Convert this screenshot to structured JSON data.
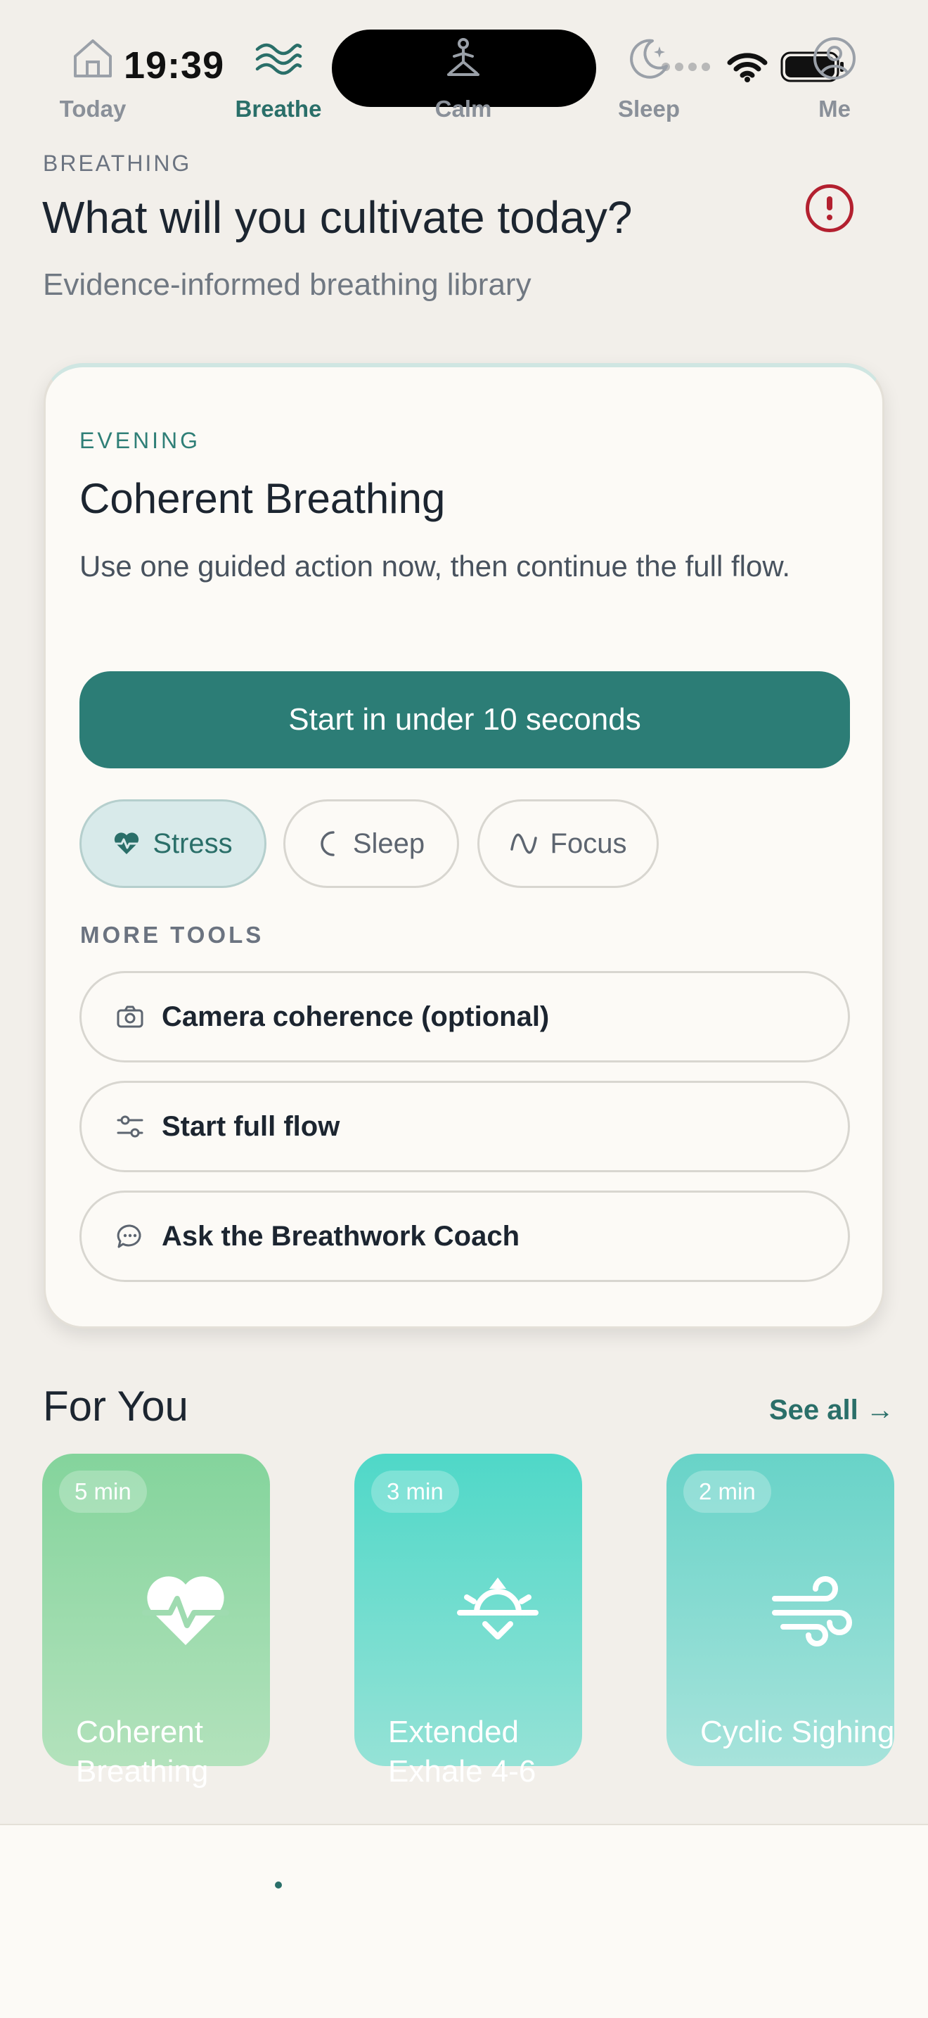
{
  "status_bar": {
    "time": "19:39"
  },
  "header": {
    "eyebrow": "BREATHING",
    "title": "What will you cultivate today?",
    "subtitle": "Evidence-informed breathing library",
    "alert_icon": "alert-circle-icon"
  },
  "hero": {
    "eyebrow": "EVENING",
    "title": "Coherent Breathing",
    "description": "Use one guided action now, then continue the full flow.",
    "cta_label": "Start in under 10 seconds",
    "chips": [
      {
        "label": "Stress",
        "icon": "heart-pulse-icon",
        "active": true
      },
      {
        "label": "Sleep",
        "icon": "moon-icon",
        "active": false
      },
      {
        "label": "Focus",
        "icon": "wave-icon",
        "active": false
      }
    ],
    "more_tools_label": "MORE TOOLS",
    "tools": [
      {
        "label": "Camera coherence (optional)",
        "icon": "camera-icon"
      },
      {
        "label": "Start full flow",
        "icon": "sliders-icon"
      },
      {
        "label": "Ask the Breathwork Coach",
        "icon": "chat-bubble-icon"
      }
    ]
  },
  "for_you": {
    "title": "For You",
    "see_all": "See all →",
    "cards": [
      {
        "duration": "5 min",
        "title": "Coherent Breathing",
        "icon": "heart-pulse-icon",
        "color": "#84d49c"
      },
      {
        "duration": "3 min",
        "title": "Extended Exhale 4-6",
        "icon": "sunset-icon",
        "color": "#4fd8c8"
      },
      {
        "duration": "2 min",
        "title": "Cyclic Sighing",
        "icon": "wind-icon",
        "color": "#68d3c8"
      }
    ]
  },
  "tab_bar": {
    "tabs": [
      {
        "label": "Today",
        "icon": "home-icon",
        "active": false
      },
      {
        "label": "Breathe",
        "icon": "waves-icon",
        "active": true
      },
      {
        "label": "Calm",
        "icon": "meditation-icon",
        "active": false
      },
      {
        "label": "Sleep",
        "icon": "moon-stars-icon",
        "active": false
      },
      {
        "label": "Me",
        "icon": "user-circle-icon",
        "active": false
      }
    ]
  },
  "colors": {
    "accent": "#2c7d76",
    "alert": "#b3202f",
    "background": "#f2efea",
    "card": "#fcfaf6"
  }
}
